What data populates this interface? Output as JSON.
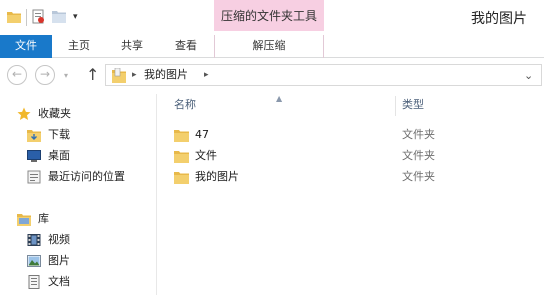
{
  "window": {
    "title": "我的图片",
    "context_tool_header": "压缩的文件夹工具"
  },
  "quick_access": {
    "dropdown_icon": "chevron-down"
  },
  "ribbon": {
    "tabs": [
      {
        "label": "文件",
        "active": true
      },
      {
        "label": "主页"
      },
      {
        "label": "共享"
      },
      {
        "label": "查看"
      },
      {
        "label": "解压缩"
      }
    ]
  },
  "address_bar": {
    "path": [
      "我的图片"
    ],
    "back_icon": "arrow-left",
    "forward_icon": "arrow-right",
    "up_icon": "arrow-up"
  },
  "nav_pane": {
    "favorites": {
      "label": "收藏夹",
      "items": [
        {
          "label": "下载"
        },
        {
          "label": "桌面"
        },
        {
          "label": "最近访问的位置"
        }
      ]
    },
    "libraries": {
      "label": "库",
      "items": [
        {
          "label": "视频"
        },
        {
          "label": "图片"
        },
        {
          "label": "文档"
        }
      ]
    }
  },
  "file_list": {
    "columns": {
      "name": "名称",
      "type": "类型"
    },
    "rows": [
      {
        "name": "47",
        "type": "文件夹"
      },
      {
        "name": "文件",
        "type": "文件夹"
      },
      {
        "name": "我的图片",
        "type": "文件夹"
      }
    ]
  },
  "colors": {
    "file_tab": "#1979ca",
    "context_header": "#f7cfe2",
    "folder": "#e8b94a"
  }
}
